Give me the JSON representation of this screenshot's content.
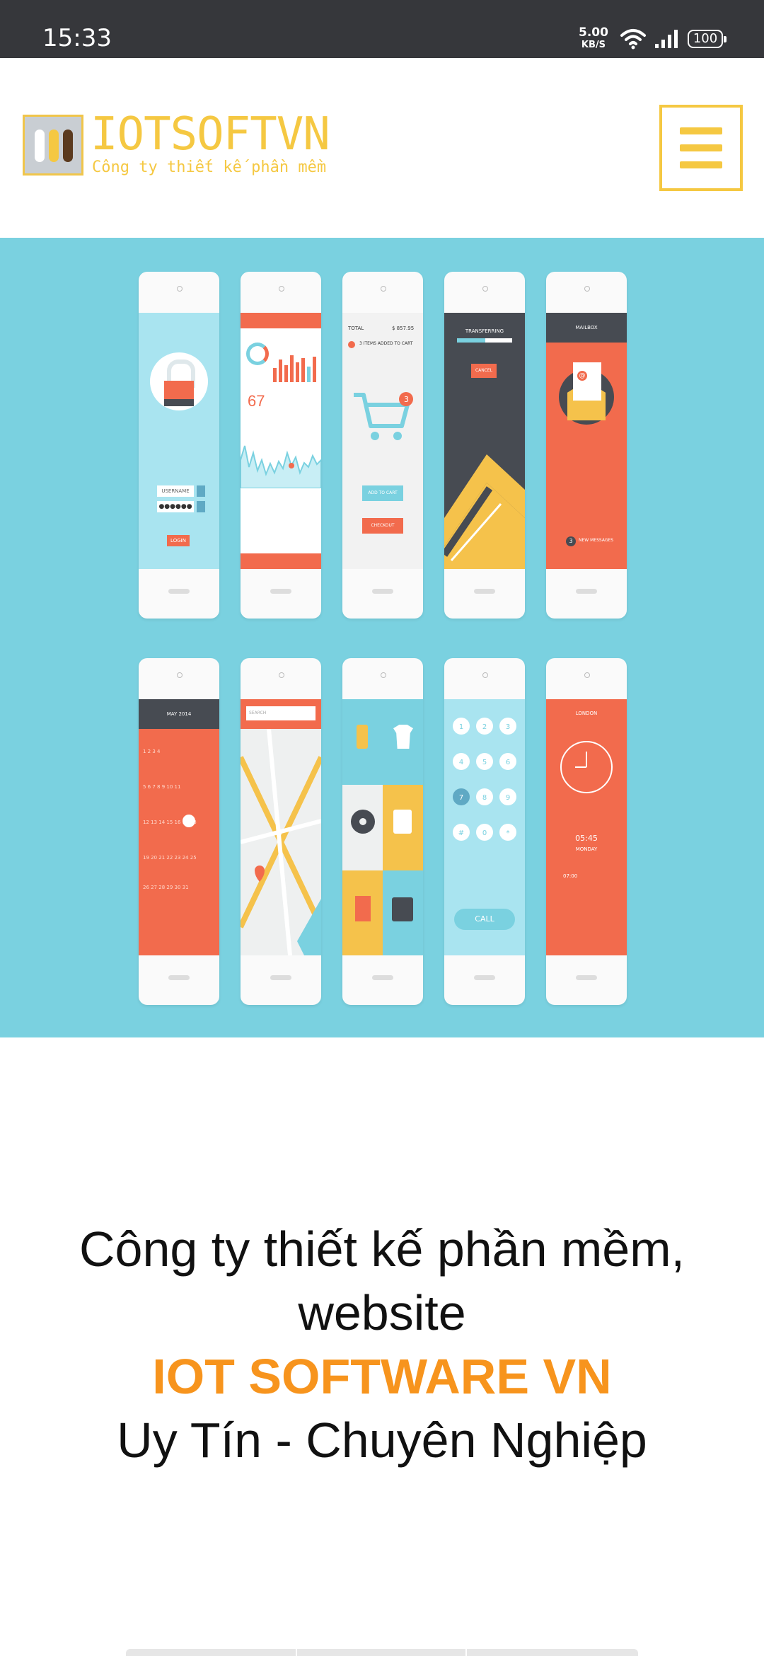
{
  "status_bar": {
    "time": "15:33",
    "speed_value": "5.00",
    "speed_unit": "KB/S",
    "battery": "100"
  },
  "header": {
    "brand_title": "IOTSOFTVN",
    "brand_subtitle": "Công ty thiết kế phần mềm",
    "menu_icon": "hamburger-icon"
  },
  "hero": {
    "phones": [
      {
        "name": "login",
        "texts": {
          "username": "USERNAME",
          "login": "LOGIN"
        }
      },
      {
        "name": "stats",
        "texts": {
          "value": "67"
        }
      },
      {
        "name": "cart",
        "texts": {
          "total": "TOTAL",
          "amount": "$ 857.95",
          "items": "3 ITEMS ADDED TO CART",
          "add": "ADD TO CART",
          "checkout": "CHECKOUT"
        }
      },
      {
        "name": "transfer",
        "texts": {
          "title": "TRANSFERRING",
          "cancel": "CANCEL"
        }
      },
      {
        "name": "mailbox",
        "texts": {
          "title": "MAILBOX",
          "messages": "NEW MESSAGES",
          "count": "3"
        }
      },
      {
        "name": "calendar",
        "texts": {
          "month": "MAY 2014"
        }
      },
      {
        "name": "map",
        "texts": {
          "search": "SEARCH"
        }
      },
      {
        "name": "shop",
        "texts": {}
      },
      {
        "name": "dialer",
        "texts": {
          "call": "CALL"
        }
      },
      {
        "name": "clock",
        "texts": {
          "city": "LONDON",
          "time": "05:45",
          "day": "MONDAY",
          "alarm": "07:00"
        }
      }
    ]
  },
  "tagline": {
    "line1": "Công ty thiết kế phần mềm,",
    "line2": "website",
    "line3": "IOT SOFTWARE VN",
    "line4": "Uy Tín - Chuyên Nghiệp"
  },
  "colors": {
    "brand_yellow": "#f5c842",
    "accent_orange": "#f7941d",
    "hero_bg": "#7ad1e0",
    "phone_orange": "#f26b4d",
    "phone_dark": "#474b52"
  }
}
